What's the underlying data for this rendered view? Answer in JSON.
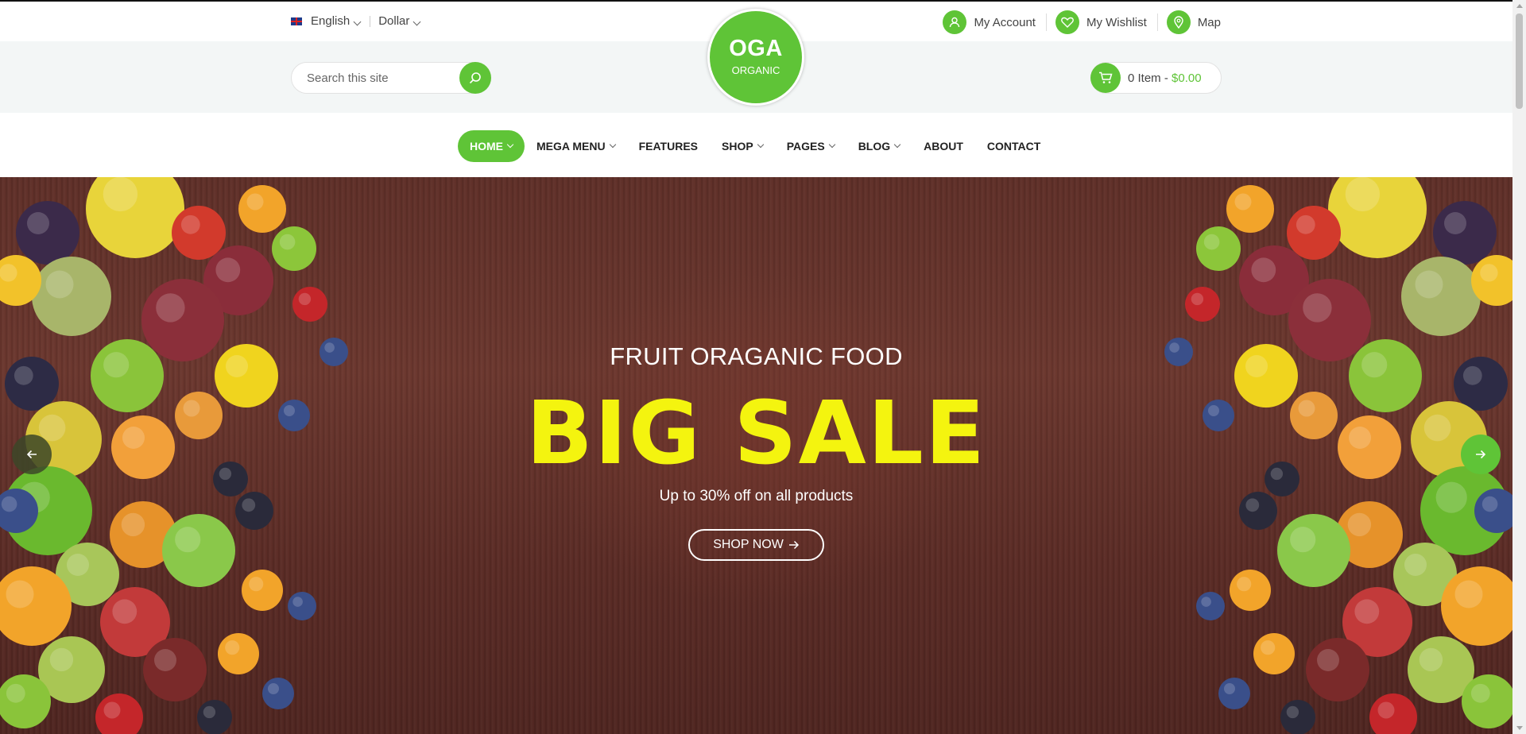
{
  "topbar": {
    "language": "English",
    "currency": "Dollar",
    "links": [
      {
        "label": "My Account",
        "icon": "user-icon"
      },
      {
        "label": "My Wishlist",
        "icon": "heart-icon"
      },
      {
        "label": "Map",
        "icon": "map-pin-icon"
      }
    ]
  },
  "search": {
    "placeholder": "Search this site"
  },
  "logo": {
    "line1": "OGA",
    "line2": "ORGANIC"
  },
  "cart": {
    "count_label": "0  Item - ",
    "total": "$0.00"
  },
  "nav": {
    "items": [
      {
        "label": "HOME",
        "has_dropdown": true,
        "active": true
      },
      {
        "label": "MEGA MENU",
        "has_dropdown": true
      },
      {
        "label": "FEATURES",
        "has_dropdown": false
      },
      {
        "label": "SHOP",
        "has_dropdown": true
      },
      {
        "label": "PAGES",
        "has_dropdown": true
      },
      {
        "label": "BLOG",
        "has_dropdown": true
      },
      {
        "label": "ABOUT",
        "has_dropdown": false
      },
      {
        "label": "CONTACT",
        "has_dropdown": false
      }
    ]
  },
  "hero": {
    "kicker": "FRUIT ORAGANIC FOOD",
    "headline": "BIG SALE",
    "subtitle": "Up to 30% off on all products",
    "cta_label": "SHOP NOW",
    "prev_icon": "arrow-left-icon",
    "next_icon": "arrow-right-icon"
  },
  "colors": {
    "accent": "#5fc437",
    "headline": "#f4f40f",
    "hero_bg": "#5f2f28",
    "band_bg": "#f3f6f6"
  }
}
